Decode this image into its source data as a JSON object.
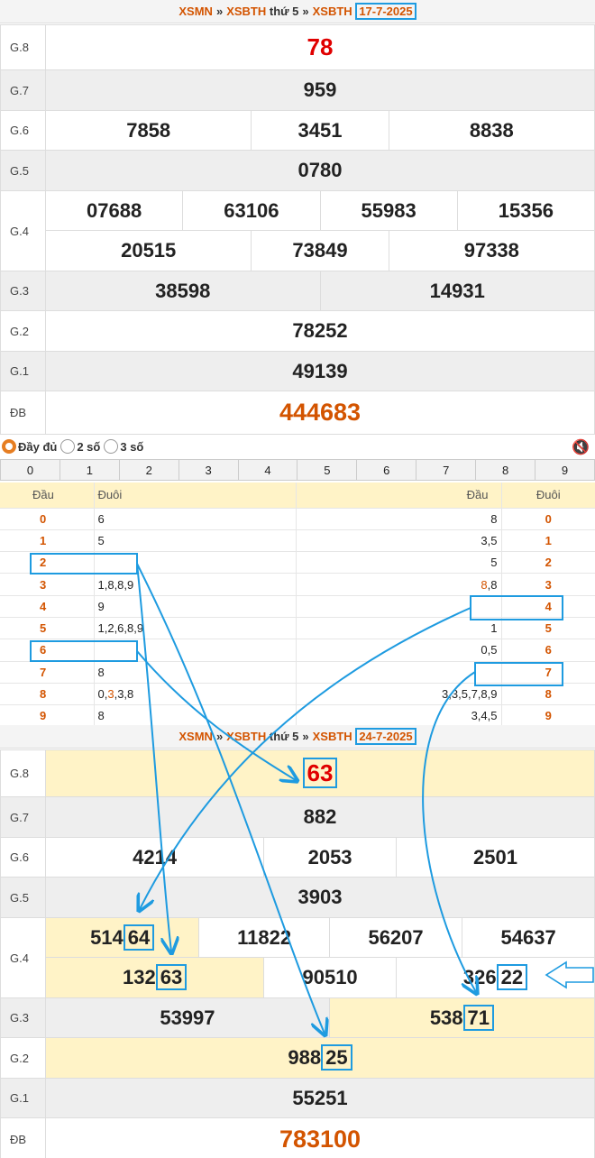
{
  "colors": {
    "accent": "#d35400",
    "annotation": "#1e9be0",
    "highlight": "#fff3c7",
    "prize8": "#e00000"
  },
  "draw1": {
    "crumb": [
      "XSMN",
      "XSBTH",
      "thứ 5",
      "XSBTH",
      "17-7-2025"
    ],
    "labels": [
      "G.8",
      "G.7",
      "G.6",
      "G.5",
      "G.4",
      "G.3",
      "G.2",
      "G.1",
      "ĐB"
    ],
    "g8": "78",
    "g7": "959",
    "g6": [
      "7858",
      "3451",
      "8838"
    ],
    "g5": "0780",
    "g4": [
      "07688",
      "63106",
      "55983",
      "15356",
      "20515",
      "73849",
      "97338"
    ],
    "g3": [
      "38598",
      "14931"
    ],
    "g2": "78252",
    "g1": "49139",
    "db": "444683"
  },
  "options": {
    "full": "Đầy đủ",
    "two": "2 số",
    "three": "3 số",
    "mute_icon": "🔇"
  },
  "digits": [
    "0",
    "1",
    "2",
    "3",
    "4",
    "5",
    "6",
    "7",
    "8",
    "9"
  ],
  "dau_duoi": {
    "h_dau": "Đầu",
    "h_duoi": "Đuôi",
    "rows": [
      {
        "d": "0",
        "duoi": "6",
        "dau": "8",
        "n": "0"
      },
      {
        "d": "1",
        "duoi": "5",
        "dau": "3,5",
        "n": "1"
      },
      {
        "d": "2",
        "duoi": "",
        "dau": "5",
        "n": "2"
      },
      {
        "d": "3",
        "duoi": "1,8,8,9",
        "dau_hl": "8",
        "dau_rest": ",8",
        "n": "3"
      },
      {
        "d": "4",
        "duoi": "9",
        "dau": "",
        "n": "4"
      },
      {
        "d": "5",
        "duoi": "1,2,6,8,9",
        "dau": "1",
        "n": "5"
      },
      {
        "d": "6",
        "duoi": "",
        "dau": "0,5",
        "n": "6"
      },
      {
        "d": "7",
        "duoi": "8",
        "dau": "",
        "n": "7"
      },
      {
        "d": "8",
        "duoi_a": "0,",
        "duoi_hl": "3",
        "duoi_b": ",3,8",
        "dau": "3,3,5,7,8,9",
        "n": "8"
      },
      {
        "d": "9",
        "duoi": "8",
        "dau": "3,4,5",
        "n": "9"
      }
    ]
  },
  "draw2": {
    "crumb": [
      "XSMN",
      "XSBTH",
      "thứ 5",
      "XSBTH",
      "24-7-2025"
    ],
    "g8": "63",
    "g7": "882",
    "g6": [
      "4214",
      "2053",
      "2501"
    ],
    "g5": "3903",
    "g4a": {
      "pre": "514",
      "hl": "64"
    },
    "g4b": "11822",
    "g4c": "56207",
    "g4d": "54637",
    "g4e": {
      "pre": "132",
      "hl": "63"
    },
    "g4f": "90510",
    "g4g": {
      "pre": "326",
      "hl": "22"
    },
    "g3a": "53997",
    "g3b": {
      "pre": "538",
      "hl": "71"
    },
    "g2": {
      "pre": "988",
      "hl": "25"
    },
    "g1": "55251",
    "db": "783100"
  }
}
